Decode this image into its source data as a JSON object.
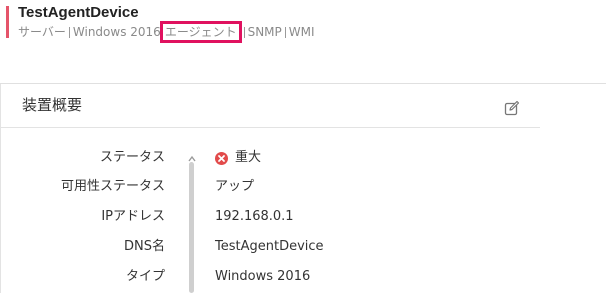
{
  "header": {
    "title": "TestAgentDevice",
    "tags": [
      "サーバー",
      "Windows 2016",
      "エージェント",
      "SNMP",
      "WMI"
    ],
    "highlighted_tag": "エージェント",
    "accent_color": "#e5546a",
    "highlight_color": "#e0115f"
  },
  "panel": {
    "title": "装置概要",
    "edit_icon": "edit-icon",
    "rows": [
      {
        "label": "ステータス",
        "value": "重大",
        "icon": "critical-status-icon"
      },
      {
        "label": "可用性ステータス",
        "value": "アップ"
      },
      {
        "label": "IPアドレス",
        "value": "192.168.0.1"
      },
      {
        "label": "DNS名",
        "value": "TestAgentDevice"
      },
      {
        "label": "タイプ",
        "value": "Windows 2016"
      }
    ],
    "status_color": "#e24b4b"
  }
}
